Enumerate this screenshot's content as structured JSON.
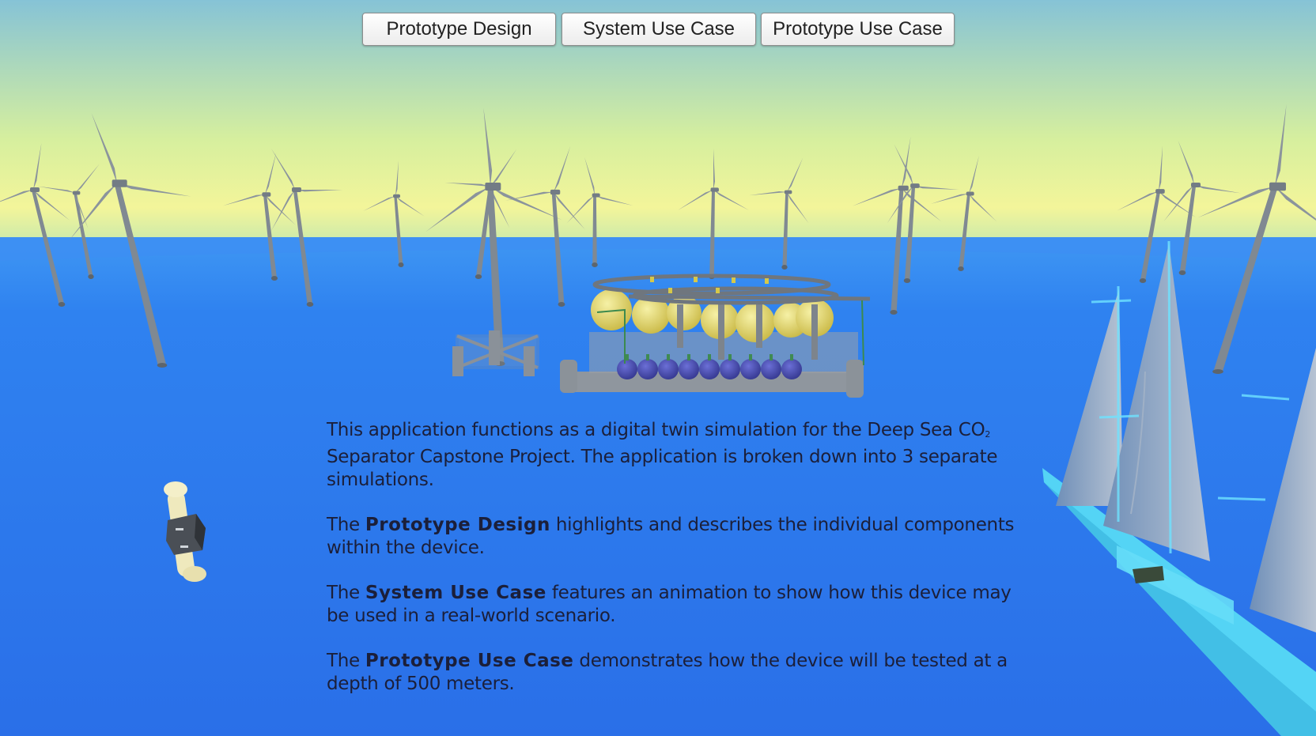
{
  "nav": {
    "prototype_design": "Prototype Design",
    "system_use_case": "System Use Case",
    "prototype_use_case": "Prototype Use Case"
  },
  "intro": {
    "line_a": "This application functions as a digital twin simulation for the Deep Sea CO",
    "subscript": "2",
    "line_b": " Separator Capstone Project. The application is broken down into 3 separate simulations."
  },
  "sections": [
    {
      "prefix": "The ",
      "name": "Prototype Design",
      "rest": " highlights and describes the individual components within the device."
    },
    {
      "prefix": "The ",
      "name": "System Use Case",
      "rest": " features an animation to show how this device may be used in a real-world scenario."
    },
    {
      "prefix": "The ",
      "name": "Prototype Use Case",
      "rest": " demonstrates how the device will be tested at a depth of 500 meters."
    }
  ],
  "colors": {
    "sky_top": "#86c3d6",
    "sky_horizon": "#f3f59a",
    "sea": "#2f7cf0",
    "turbine": "#7e8790",
    "tank_yellow": "#e8dd6a",
    "tank_blue": "#4b4fb8",
    "ship": "#4fd1f0"
  }
}
